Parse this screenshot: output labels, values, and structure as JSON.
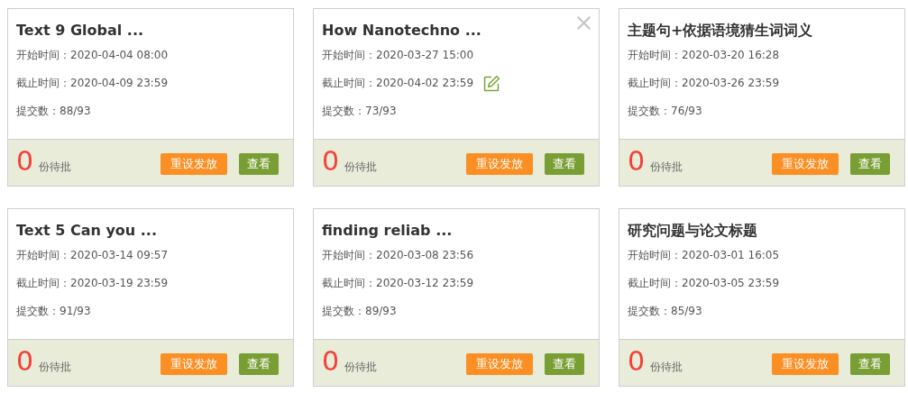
{
  "cards": [
    {
      "title": "Text 9 Global ...",
      "start": "开始时间：2020-04-04 08:00",
      "deadline": "截止时间：2020-04-09 23:59",
      "submissions": "提交数：88/93",
      "pending_count": "0",
      "pending_label": "份待批",
      "reset_button": "重设发放",
      "view_button": "查看",
      "hovered": false
    },
    {
      "title": "How Nanotechno ...",
      "start": "开始时间：2020-03-27 15:00",
      "deadline": "截止时间：2020-04-02 23:59",
      "submissions": "提交数：73/93",
      "pending_count": "0",
      "pending_label": "份待批",
      "reset_button": "重设发放",
      "view_button": "查看",
      "hovered": true
    },
    {
      "title": "主题句+依据语境猜生词词义",
      "start": "开始时间：2020-03-20 16:28",
      "deadline": "截止时间：2020-03-26 23:59",
      "submissions": "提交数：76/93",
      "pending_count": "0",
      "pending_label": "份待批",
      "reset_button": "重设发放",
      "view_button": "查看",
      "hovered": false
    },
    {
      "title": "Text 5 Can you ...",
      "start": "开始时间：2020-03-14 09:57",
      "deadline": "截止时间：2020-03-19 23:59",
      "submissions": "提交数：91/93",
      "pending_count": "0",
      "pending_label": "份待批",
      "reset_button": "重设发放",
      "view_button": "查看",
      "hovered": false
    },
    {
      "title": "finding reliab ...",
      "start": "开始时间：2020-03-08 23:56",
      "deadline": "截止时间：2020-03-12 23:59",
      "submissions": "提交数：89/93",
      "pending_count": "0",
      "pending_label": "份待批",
      "reset_button": "重设发放",
      "view_button": "查看",
      "hovered": false
    },
    {
      "title": "研究问题与论文标题",
      "start": "开始时间：2020-03-01 16:05",
      "deadline": "截止时间：2020-03-05 23:59",
      "submissions": "提交数：85/93",
      "pending_count": "0",
      "pending_label": "份待批",
      "reset_button": "重设发放",
      "view_button": "查看",
      "hovered": false
    }
  ]
}
